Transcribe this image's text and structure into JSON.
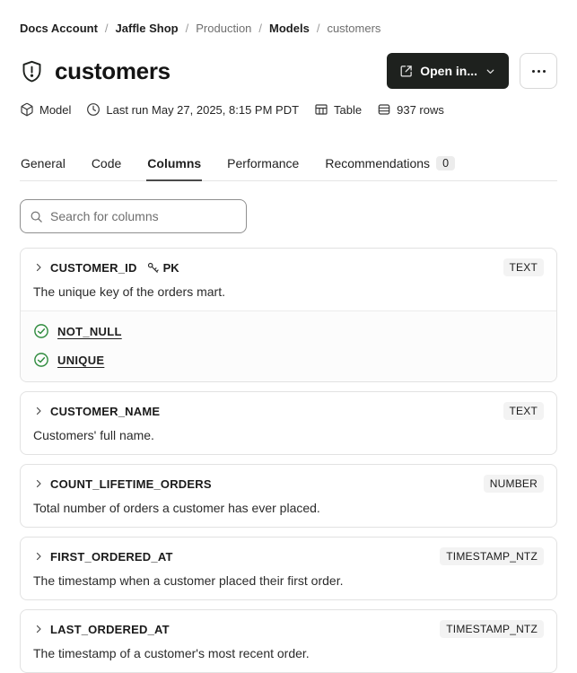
{
  "breadcrumb": {
    "separator": "/",
    "items": [
      {
        "label": "Docs Account",
        "muted": false
      },
      {
        "label": "Jaffle Shop",
        "muted": false
      },
      {
        "label": "Production",
        "muted": true
      },
      {
        "label": "Models",
        "muted": false
      },
      {
        "label": "customers",
        "muted": true
      }
    ]
  },
  "header": {
    "title": "customers",
    "open_in_label": "Open in..."
  },
  "meta": {
    "items": [
      {
        "icon": "cube-icon",
        "label": "Model"
      },
      {
        "icon": "clock-icon",
        "label": "Last run May 27, 2025, 8:15 PM PDT"
      },
      {
        "icon": "table-icon",
        "label": "Table"
      },
      {
        "icon": "database-icon",
        "label": "937 rows"
      }
    ]
  },
  "tabs": [
    {
      "label": "General",
      "active": false
    },
    {
      "label": "Code",
      "active": false
    },
    {
      "label": "Columns",
      "active": true
    },
    {
      "label": "Performance",
      "active": false
    },
    {
      "label": "Recommendations",
      "active": false,
      "badge": "0"
    }
  ],
  "search": {
    "placeholder": "Search for columns"
  },
  "columns": [
    {
      "name": "CUSTOMER_ID",
      "pk": "PK",
      "type": "TEXT",
      "description": "The unique key of the orders mart.",
      "tests": [
        "NOT_NULL",
        "UNIQUE"
      ]
    },
    {
      "name": "CUSTOMER_NAME",
      "type": "TEXT",
      "description": "Customers' full name."
    },
    {
      "name": "COUNT_LIFETIME_ORDERS",
      "type": "NUMBER",
      "description": "Total number of orders a customer has ever placed."
    },
    {
      "name": "FIRST_ORDERED_AT",
      "type": "TIMESTAMP_NTZ",
      "description": "The timestamp when a customer placed their first order."
    },
    {
      "name": "LAST_ORDERED_AT",
      "type": "TIMESTAMP_NTZ",
      "description": "The timestamp of a customer's most recent order."
    }
  ],
  "colors": {
    "button_dark": "#1e211e",
    "test_green": "#2e8b3d",
    "badge_bg": "#f3f3f3",
    "active_tab_underline": "#4a4a4a"
  }
}
